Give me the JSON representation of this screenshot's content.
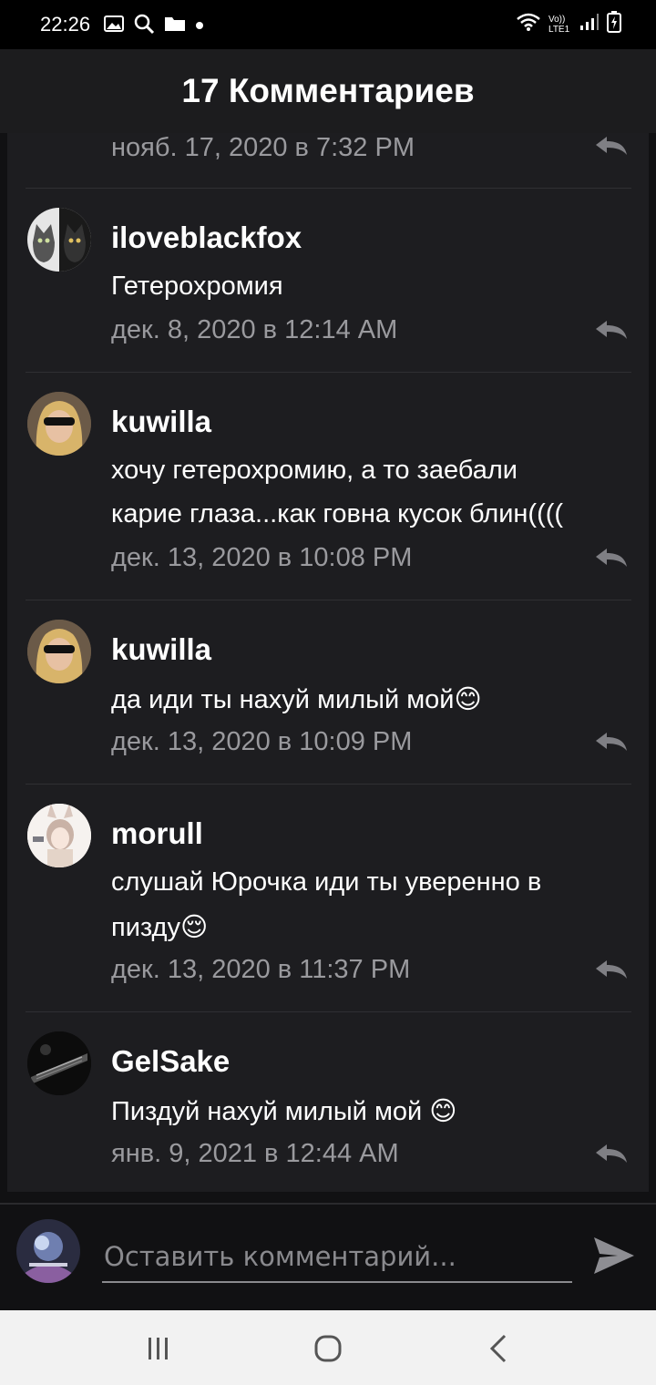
{
  "status_bar": {
    "time": "22:26",
    "network_label": "Vo)) LTE1"
  },
  "header": {
    "title": "17 Комментариев"
  },
  "partial_comment": {
    "timestamp": "нояб. 17, 2020 в 7:32 PM"
  },
  "comments": [
    {
      "author": "iloveblackfox",
      "lines": [
        "Гетерохромия"
      ],
      "timestamp": "дек. 8, 2020 в 12:14 AM"
    },
    {
      "author": "kuwilla",
      "lines": [
        "хочу гетерохромию, а то заебали",
        "карие глаза...как говна кусок блин(((("
      ],
      "timestamp": "дек. 13, 2020 в 10:08 PM"
    },
    {
      "author": "kuwilla",
      "lines": [
        "да иди ты нахуй милый мой😊"
      ],
      "timestamp": "дек. 13, 2020 в 10:09 PM"
    },
    {
      "author": "morull",
      "lines": [
        "слушай Юрочка иди ты уверенно в",
        "пизду😌"
      ],
      "timestamp": "дек. 13, 2020 в 11:37 PM"
    },
    {
      "author": "GelSake",
      "lines": [
        "Пиздуй нахуй милый мой 😊"
      ],
      "timestamp": "янв. 9, 2021 в 12:44 AM"
    }
  ],
  "composer": {
    "placeholder": "Оставить комментарий..."
  },
  "colors": {
    "background": "#111113",
    "panel": "#1d1d20",
    "header": "#1c1c1e",
    "timestamp": "#9a9a9e",
    "nav_bar": "#f2f2f2"
  }
}
